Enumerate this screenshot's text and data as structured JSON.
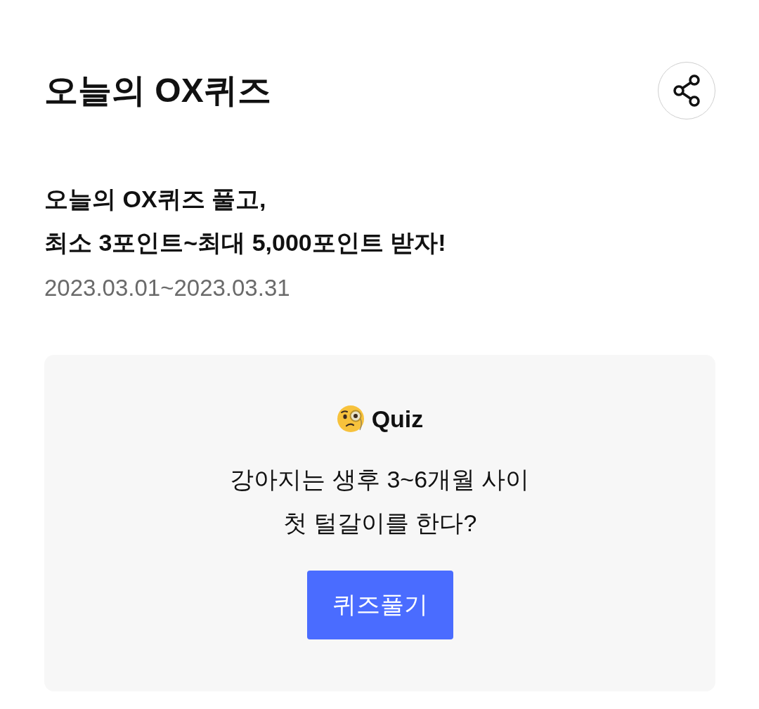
{
  "page": {
    "title": "오늘의 OX퀴즈"
  },
  "event": {
    "headline": "오늘의 OX퀴즈 풀고,\n최소 3포인트~최대 5,000포인트 받자!",
    "period": "2023.03.01~2023.03.31"
  },
  "quiz_card": {
    "label": "Quiz",
    "question": "강아지는 생후 3~6개월 사이\n첫 털갈이를 한다?",
    "button": "퀴즈풀기"
  }
}
